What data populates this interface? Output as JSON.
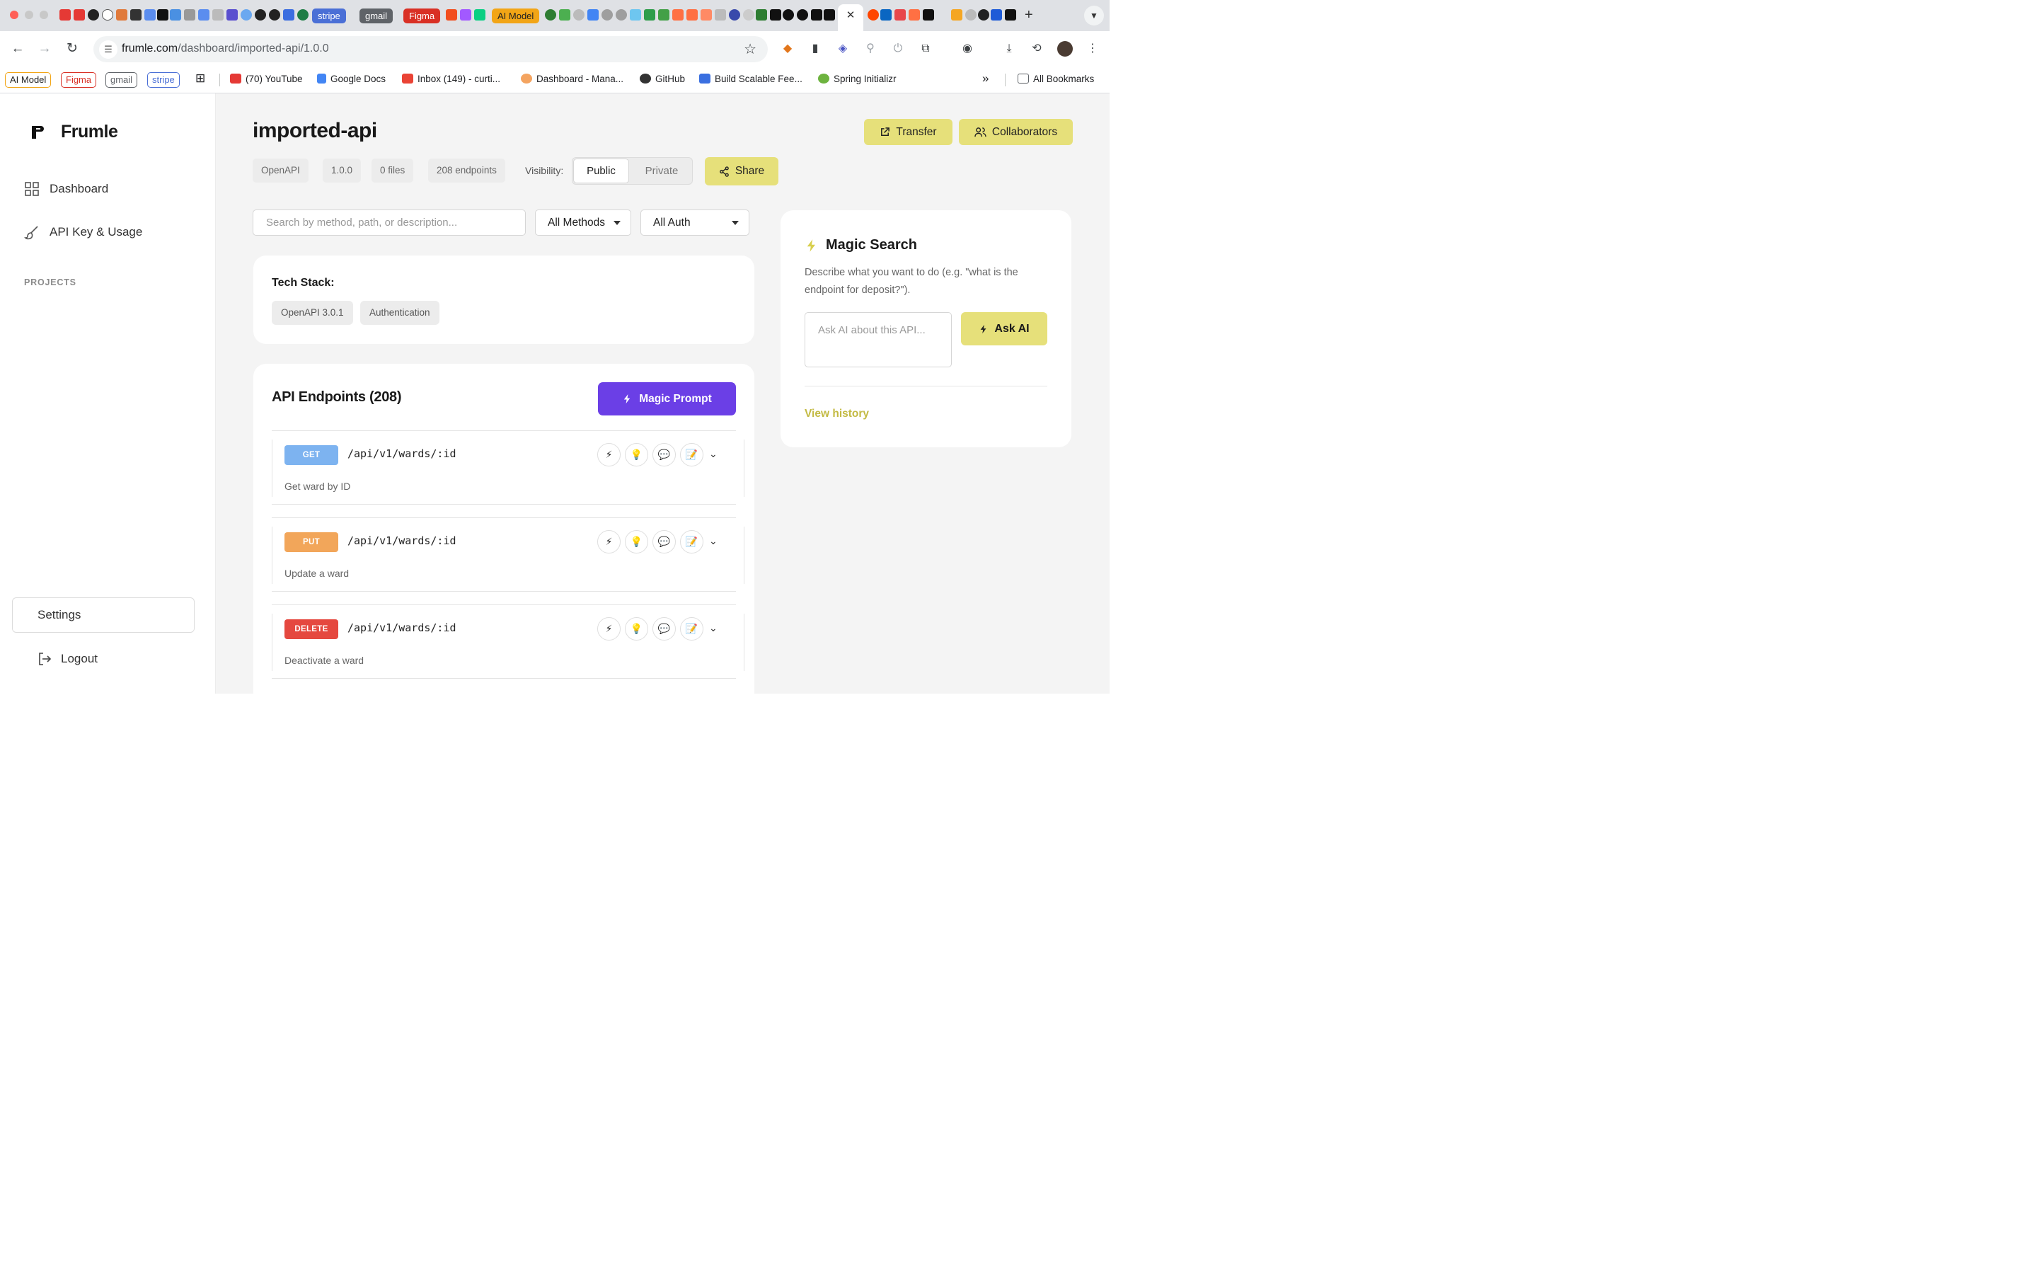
{
  "browser": {
    "tab_chips": [
      {
        "label": "stripe",
        "color": "#4a6fd6"
      },
      {
        "label": "gmail",
        "color": "#5f6368"
      },
      {
        "label": "Figma",
        "color": "#d93025"
      },
      {
        "label": "AI Model",
        "color": "#f2a516"
      }
    ],
    "active_tab_close": "✕",
    "address": {
      "host": "frumle.com",
      "path": "/dashboard/imported-api/1.0.0"
    },
    "bookmarks": {
      "chips": [
        {
          "label": "AI Model",
          "color": "#f2a516"
        },
        {
          "label": "Figma",
          "color": "#d93025"
        },
        {
          "label": "gmail",
          "color": "#5f6368"
        },
        {
          "label": "stripe",
          "color": "#4a6fd6"
        }
      ],
      "links": [
        "(70) YouTube",
        "Google Docs",
        "Inbox (149) - curti...",
        "Dashboard - Mana...",
        "GitHub",
        "Build Scalable Fee...",
        "Spring Initializr"
      ],
      "overflow": "»",
      "all_bookmarks": "All Bookmarks"
    }
  },
  "sidebar": {
    "brand": "Frumle",
    "nav": [
      {
        "label": "Dashboard",
        "icon": "grid-icon"
      },
      {
        "label": "API Key & Usage",
        "icon": "brush-icon"
      }
    ],
    "projects_label": "PROJECTS",
    "settings": "Settings",
    "logout": "Logout"
  },
  "header": {
    "title": "imported-api",
    "transfer": "Transfer",
    "collaborators": "Collaborators",
    "meta": [
      "OpenAPI",
      "1.0.0",
      "0 files",
      "208 endpoints"
    ],
    "visibility_label": "Visibility:",
    "visibility_options": [
      "Public",
      "Private"
    ],
    "visibility_selected": "Public",
    "share": "Share"
  },
  "filters": {
    "search_placeholder": "Search by method, path, or description...",
    "method": "All Methods",
    "auth": "All Auth"
  },
  "tech_stack": {
    "heading": "Tech Stack:",
    "items": [
      "OpenAPI 3.0.1",
      "Authentication"
    ]
  },
  "endpoints": {
    "heading": "API Endpoints (208)",
    "magic_prompt": "Magic Prompt",
    "rows": [
      {
        "method": "GET",
        "color": "#7db3f0",
        "path": "/api/v1/wards/:id",
        "description": "Get ward by ID"
      },
      {
        "method": "PUT",
        "color": "#f2a65a",
        "path": "/api/v1/wards/:id",
        "description": "Update a ward"
      },
      {
        "method": "DELETE",
        "color": "#e5483f",
        "path": "/api/v1/wards/:id",
        "description": "Deactivate a ward"
      }
    ],
    "row_icons": [
      "⚡",
      "💡",
      "💬",
      "📝"
    ]
  },
  "magic_search": {
    "title": "Magic Search",
    "description": "Describe what you want to do (e.g. \"what is the endpoint for deposit?\").",
    "placeholder": "Ask AI about this API...",
    "ask": "Ask AI",
    "history": "View history"
  },
  "colors": {
    "accent_yellow": "#e6e07a",
    "accent_purple": "#6b3fe6",
    "link_yellow": "#c3ba43"
  }
}
